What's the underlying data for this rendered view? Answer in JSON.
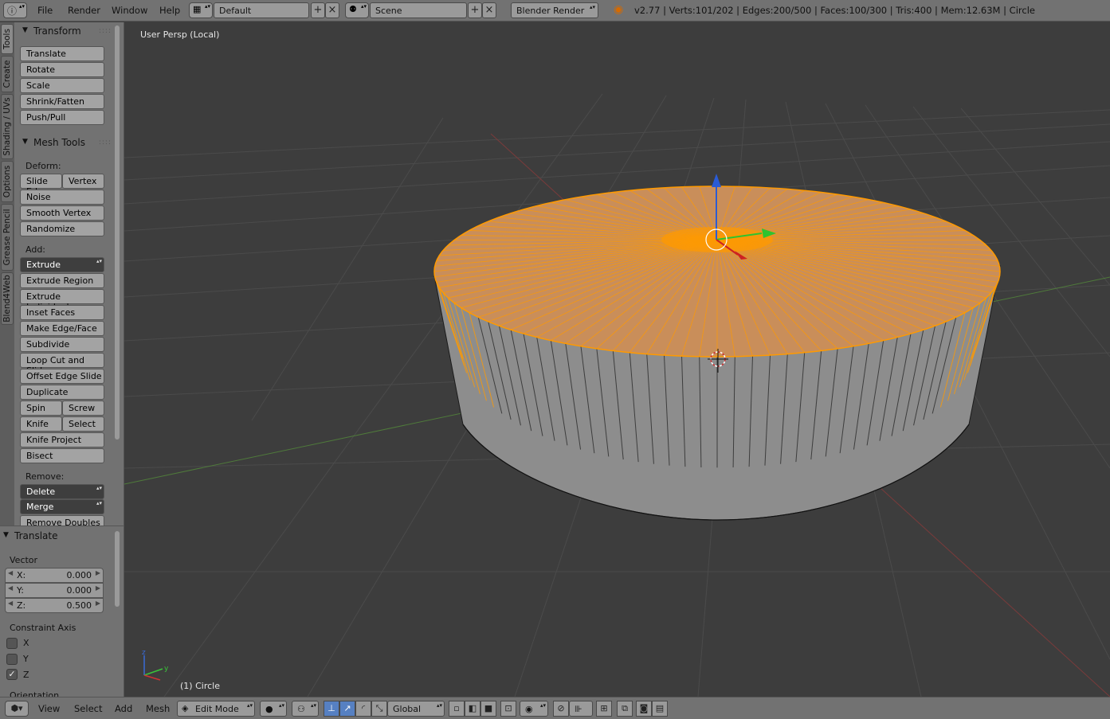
{
  "topbar": {
    "menus": [
      "File",
      "Render",
      "Window",
      "Help"
    ],
    "screen_layout": "Default",
    "scene": "Scene",
    "render_engine": "Blender Render",
    "stats": "v2.77 | Verts:101/202 | Edges:200/500 | Faces:100/300 | Tris:400 | Mem:12.63M | Circle"
  },
  "tabs": [
    "Tools",
    "Create",
    "Shading / UVs",
    "Options",
    "Grease Pencil",
    "Blend4Web"
  ],
  "toolshelf": {
    "transform": {
      "title": "Transform",
      "buttons": [
        "Translate",
        "Rotate",
        "Scale",
        "Shrink/Fatten",
        "Push/Pull"
      ]
    },
    "mesh_tools": {
      "title": "Mesh Tools",
      "deform_label": "Deform:",
      "slide_edge": "Slide Ed",
      "vertex": "Vertex",
      "noise": "Noise",
      "smooth_vertex": "Smooth Vertex",
      "randomize": "Randomize",
      "add_label": "Add:",
      "extrude": "Extrude",
      "extrude_region": "Extrude Region",
      "extrude_individual": "Extrude Individual",
      "inset_faces": "Inset Faces",
      "make_edge_face": "Make Edge/Face",
      "subdivide": "Subdivide",
      "loop_cut": "Loop Cut and Slide",
      "offset_edge_slide": "Offset Edge Slide",
      "duplicate": "Duplicate",
      "spin": "Spin",
      "screw": "Screw",
      "knife": "Knife",
      "select": "Select",
      "knife_project": "Knife Project",
      "bisect": "Bisect",
      "remove_label": "Remove:",
      "delete": "Delete",
      "merge": "Merge",
      "remove_doubles": "Remove Doubles"
    }
  },
  "operator": {
    "title": "Translate",
    "vector_label": "Vector",
    "x_label": "X:",
    "x": "0.000",
    "y_label": "Y:",
    "y": "0.000",
    "z_label": "Z:",
    "z": "0.500",
    "constraint_label": "Constraint Axis",
    "axis_x": "X",
    "axis_y": "Y",
    "axis_z": "Z",
    "constraint_z_checked": true,
    "orientation_label": "Orientation"
  },
  "viewport": {
    "title": "User Persp (Local)",
    "object_label": "(1) Circle",
    "selection_color": "#ff9a00",
    "background_color": "#3d3d3d"
  },
  "bottombar": {
    "menus": [
      "View",
      "Select",
      "Add",
      "Mesh"
    ],
    "mode": "Edit Mode",
    "orientation": "Global"
  }
}
